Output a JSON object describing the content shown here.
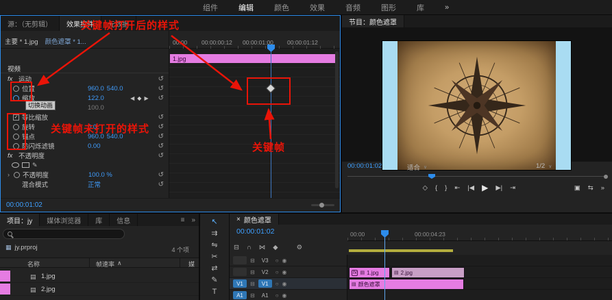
{
  "colors": {
    "accent_blue": "#2d8ceb",
    "value_blue": "#3f9bfa",
    "timecode_blue": "#3fa0ff",
    "clip_pink": "#e57ce2",
    "clip_pink_dim": "#c99fc6",
    "annotation_red": "#ea1408",
    "render_bar_yellow": "#b3ad3e",
    "preview_side_blue": "#a9dcf2",
    "parchment_tan": "#c49d66"
  },
  "icons": {
    "overflow": "»",
    "panel_menu": "≡",
    "close": "×",
    "reset": "↺",
    "check": "✓",
    "twirl": "›",
    "kf_prev": "◀",
    "kf_add": "◆",
    "kf_next": "▶",
    "caret_down": "∨",
    "sort_up": "∧",
    "eye": "◉",
    "circle": "○",
    "sync": "⊟",
    "thumb": "▤",
    "project": "▦",
    "pen": "✎",
    "marker": "◇",
    "mark_in": "{",
    "mark_out": "}",
    "go_in": "⇤",
    "step_back": "|◀",
    "play": "▶",
    "step_fwd": "▶|",
    "go_out": "⇥",
    "export_frame": "▣",
    "compare": "⇆",
    "nest": "⊟",
    "snap": "∩",
    "link": "⋈",
    "add_marker": "◆",
    "settings": "⚙",
    "tool_selection": "↖",
    "tool_track_select": "⇉",
    "tool_ripple": "⇋",
    "tool_razor": "✂",
    "tool_slip": "⇄",
    "tool_pen": "✎",
    "tool_type": "T"
  },
  "top_bar": {
    "items": [
      "组件",
      "编辑",
      "颜色",
      "效果",
      "音频",
      "图形",
      "库"
    ],
    "active": "编辑"
  },
  "effect_controls": {
    "tabs": [
      "源：（无剪辑）",
      "效果控件",
      "元数据"
    ],
    "master_clip": "主要 * 1.jpg",
    "sequence_clip": "颜色遮罩 * 1...",
    "ruler": [
      "00:00",
      "00:00:00:12",
      "00:00:01:00",
      "00:00:01:12"
    ],
    "clip_bar": "1.jpg",
    "fx_badge": "fx",
    "rows": {
      "video_section": "视频",
      "motion": "运动",
      "position": {
        "label": "位置",
        "x": "960.0",
        "y": "540.0"
      },
      "scale": {
        "label": "缩放",
        "value": "122.0"
      },
      "scale_height": "100.0",
      "uniform_scale": "等比缩放",
      "rotation": {
        "label": "旋转",
        "value": "0.0"
      },
      "anchor": {
        "label": "锚点",
        "x": "960.0",
        "y": "540.0"
      },
      "antiflicker": {
        "label": "防闪烁滤镜",
        "value": "0.00"
      },
      "opacity_group": "不透明度",
      "opacity": {
        "label": "不透明度",
        "value": "100.0 %"
      },
      "blend_mode": {
        "label": "混合模式",
        "value": "正常"
      }
    },
    "timecode": "00:00:01:02"
  },
  "program": {
    "tab": "节目：颜色遮罩",
    "timecode": "00:00:01:02",
    "fit": "适合",
    "zoom": "1/2"
  },
  "project": {
    "tabs": [
      "项目：jy",
      "媒体浏览器",
      "库",
      "信息"
    ],
    "file": "jy.prproj",
    "count": "4 个项",
    "columns": {
      "name": "名称",
      "framerate": "帧速率",
      "media": "媒"
    },
    "items": [
      {
        "name": "1.jpg"
      },
      {
        "name": "2.jpg"
      }
    ]
  },
  "timeline": {
    "tab": "颜色遮罩",
    "timecode": "00:00:01:02",
    "ruler": [
      "00:00",
      "00:00:04:23"
    ],
    "tracks": [
      {
        "patch": "",
        "label": "V3"
      },
      {
        "patch": "",
        "label": "V2"
      },
      {
        "patch": "V1",
        "label": "V1"
      },
      {
        "patch": "A1",
        "label": "A1"
      }
    ],
    "clips": {
      "jpg1": "1.jpg",
      "jpg2": "2.jpg",
      "matte": "颜色遮罩"
    }
  },
  "annotations": {
    "keyframe_on": "关键帧打开后的样式",
    "keyframe_off": "关键帧未打开的样式",
    "keyframe": "关键帧",
    "tooltip": "切换动画"
  }
}
